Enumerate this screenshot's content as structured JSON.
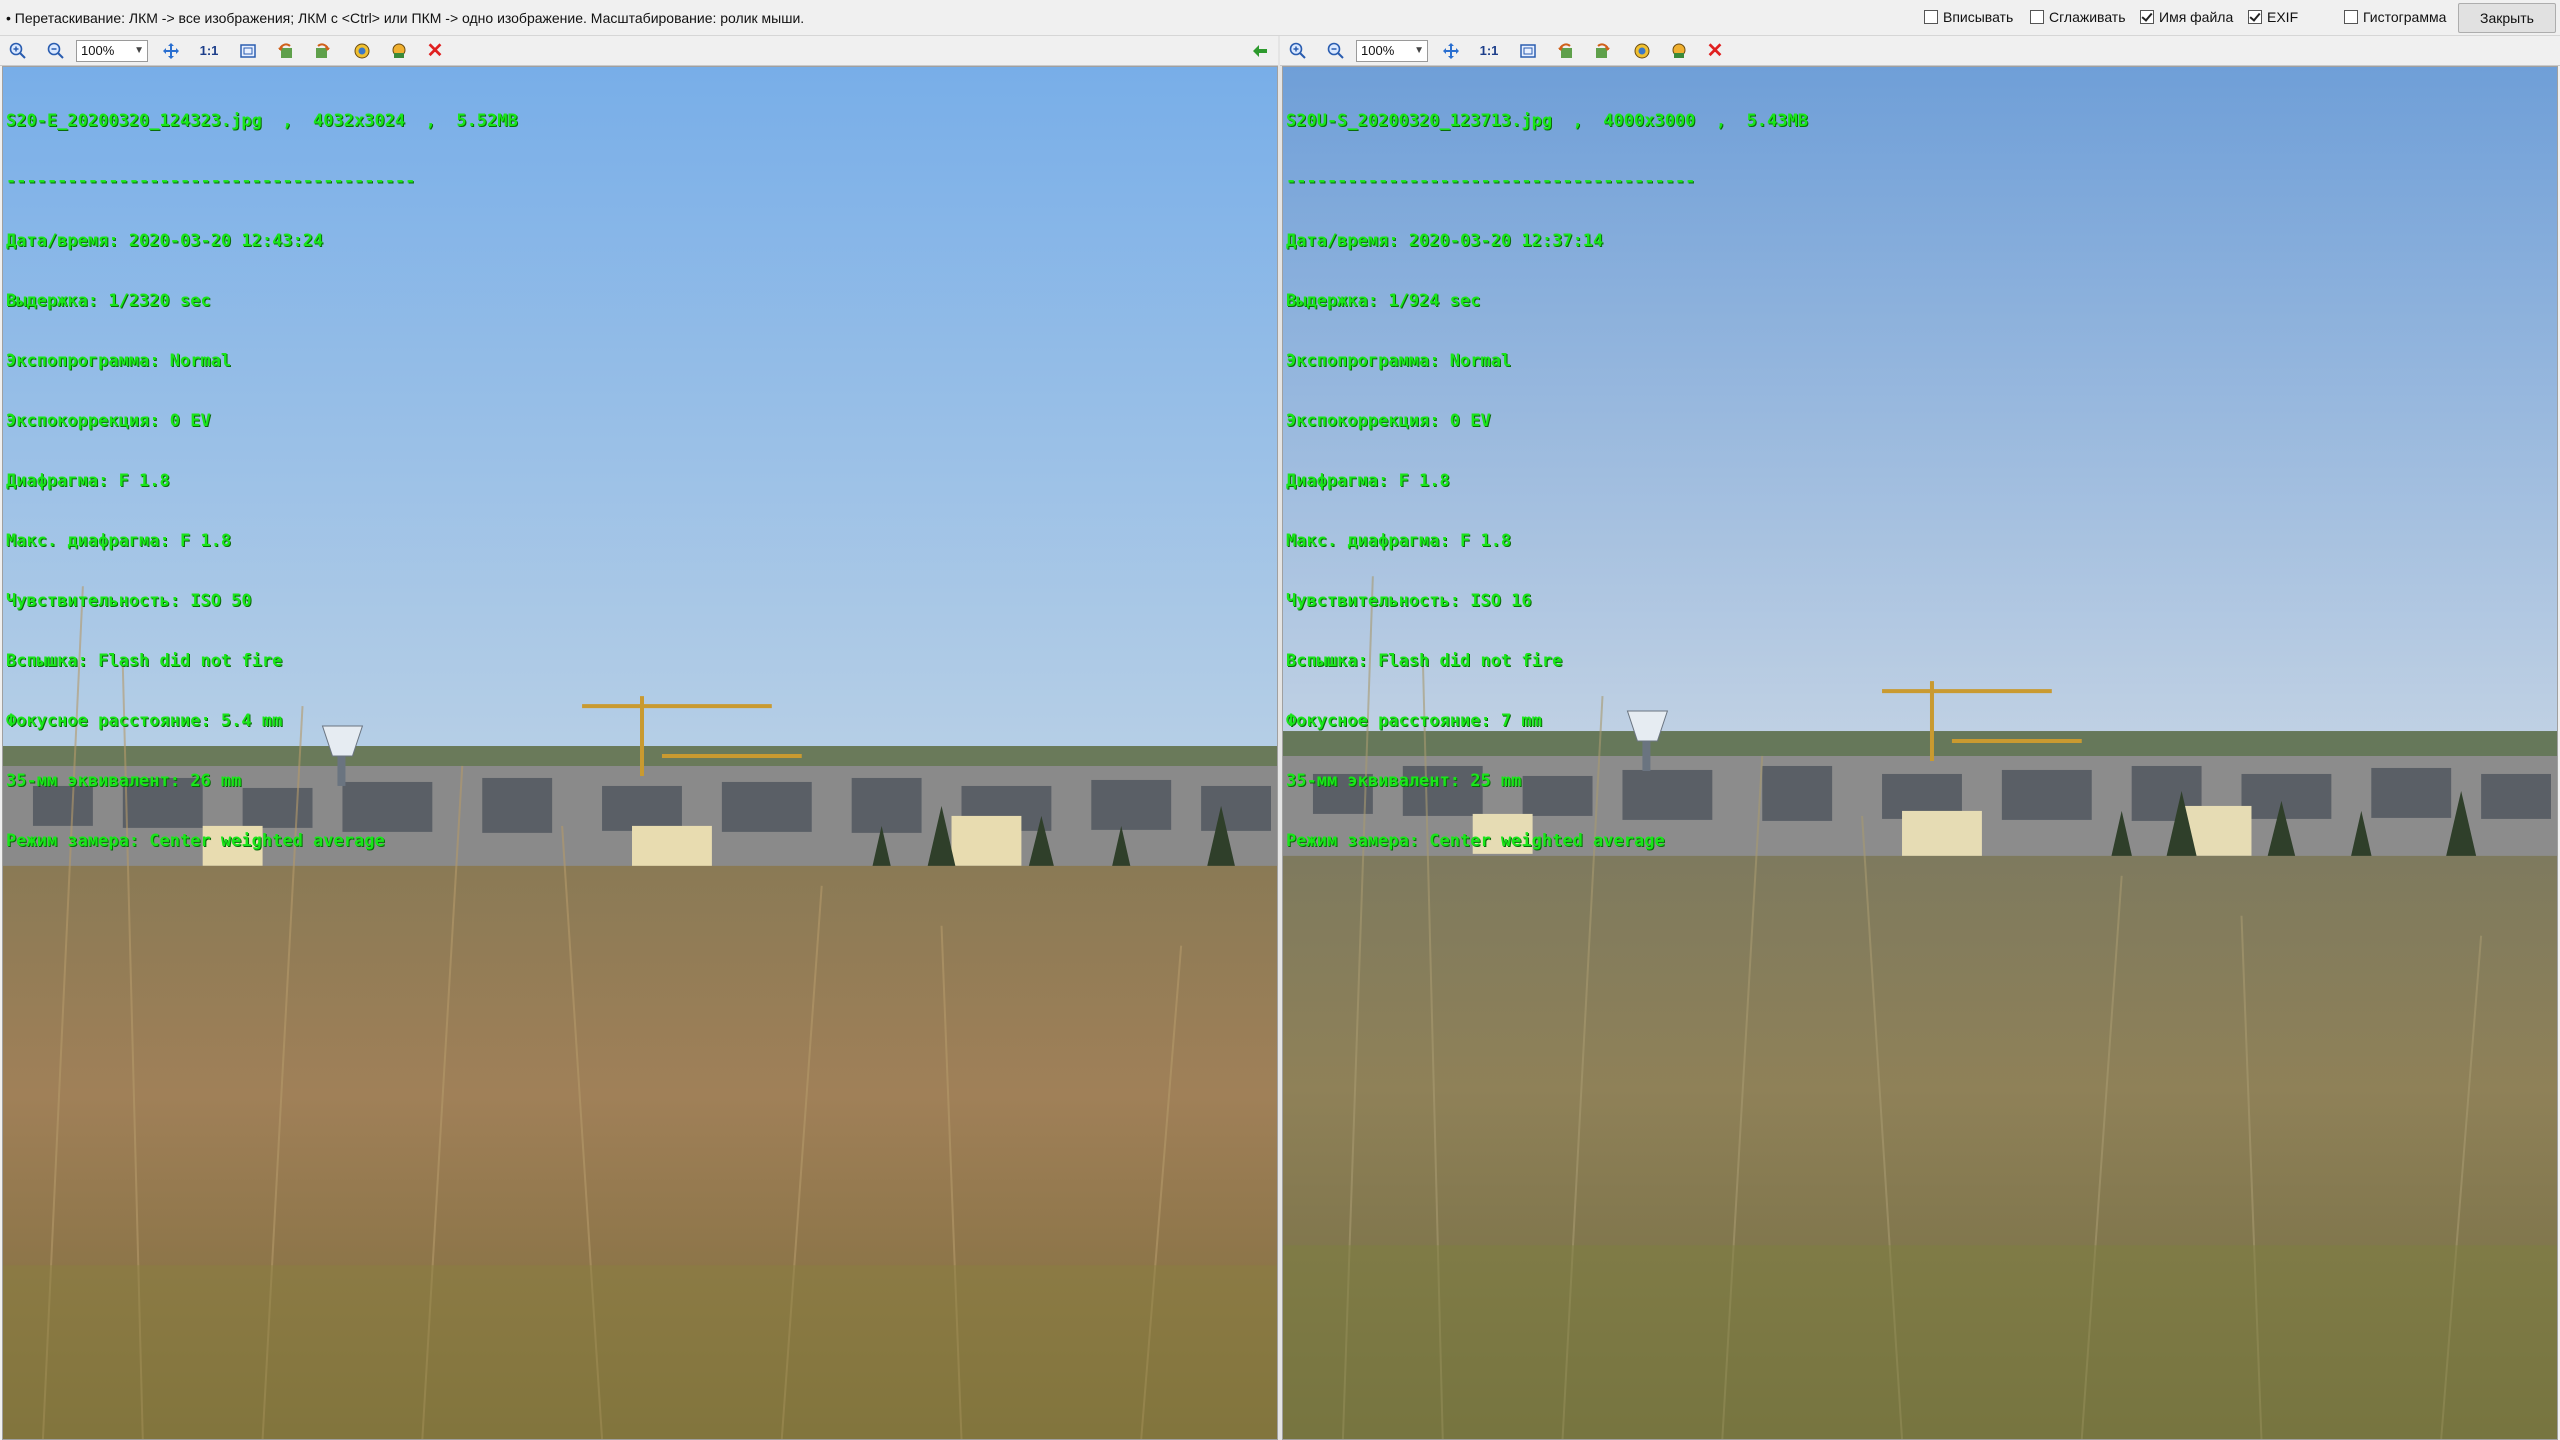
{
  "hint": "• Перетаскивание: ЛКМ -> все изображения; ЛКМ с <Ctrl> или ПКМ -> одно изображение. Масштабирование: ролик мыши.",
  "options": [
    {
      "label": "Вписывать",
      "checked": false
    },
    {
      "label": "Сглаживать",
      "checked": false
    },
    {
      "label": "Имя файла",
      "checked": true
    },
    {
      "label": "EXIF",
      "checked": true
    },
    {
      "label": "Гистограмма",
      "checked": false
    }
  ],
  "close_label": "Закрыть",
  "icons": {
    "zoom_in": "zoom-in-icon",
    "zoom_out": "zoom-out-icon",
    "move": "move-icon",
    "fit": "fit-window-icon",
    "rotate_left": "rotate-left-icon",
    "rotate_right": "rotate-right-icon",
    "compare": "compare-icon",
    "save": "save-icon",
    "close": "close-icon",
    "sync": "sync-arrow-icon"
  },
  "colors": {
    "exif_text": "#19e619",
    "close_x": "#e02020",
    "sky_top": "#7ab0e8",
    "sky_bottom": "#b5cde6"
  },
  "panels": [
    {
      "zoom": "100%",
      "ratio_label": "1:1",
      "filename": "S20-E_20200320_124323.jpg  ,  4032x3024  ,  5.52MB",
      "separator": "----------------------------------------",
      "exif": [
        "Дата/время: 2020-03-20 12:43:24",
        "Выдержка: 1/2320 sec",
        "Экспопрограмма: Normal",
        "Экспокоррекция: 0 EV",
        "Диафрагма: F 1.8",
        "Макс. диафрагма: F 1.8",
        "Чувствительность: ISO 50",
        "Вспышка: Flash did not fire",
        "Фокусное расстояние: 5.4 mm",
        "35-мм эквивалент: 26 mm",
        "Режим замера: Center weighted average"
      ]
    },
    {
      "zoom": "100%",
      "ratio_label": "1:1",
      "filename": "S20U-S_20200320_123713.jpg  ,  4000x3000  ,  5.43MB",
      "separator": "----------------------------------------",
      "exif": [
        "Дата/время: 2020-03-20 12:37:14",
        "Выдержка: 1/924 sec",
        "Экспопрограмма: Normal",
        "Экспокоррекция: 0 EV",
        "Диафрагма: F 1.8",
        "Макс. диафрагма: F 1.8",
        "Чувствительность: ISO 16",
        "Вспышка: Flash did not fire",
        "Фокусное расстояние: 7 mm",
        "35-мм эквивалент: 25 mm",
        "Режим замера: Center weighted average"
      ]
    }
  ]
}
